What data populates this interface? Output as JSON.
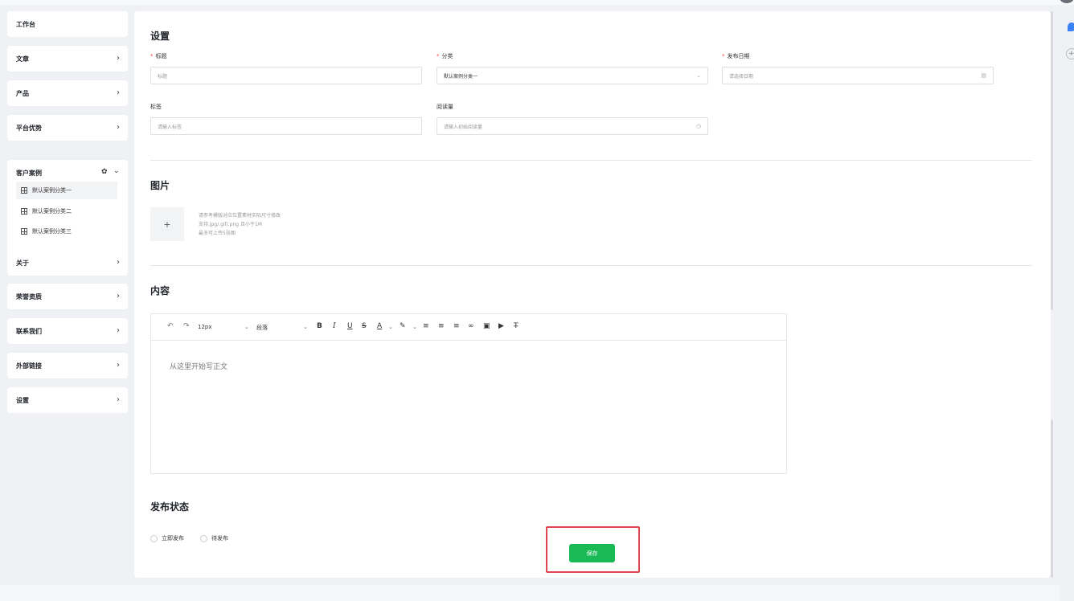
{
  "sidebar": {
    "items": [
      {
        "label": "工作台",
        "chevron": false
      },
      {
        "label": "文章",
        "chevron": true
      },
      {
        "label": "产品",
        "chevron": true
      },
      {
        "label": "平台优势",
        "chevron": true
      },
      {
        "label": "关于",
        "chevron": true
      },
      {
        "label": "荣誉资质",
        "chevron": true
      },
      {
        "label": "联系我们",
        "chevron": true
      },
      {
        "label": "外部链接",
        "chevron": true
      },
      {
        "label": "设置",
        "chevron": true
      }
    ],
    "group": {
      "label": "客户案例",
      "subitems": [
        {
          "label": "默认案例分类一",
          "active": true
        },
        {
          "label": "默认案例分类二",
          "active": false
        },
        {
          "label": "默认案例分类三",
          "active": false
        }
      ]
    },
    "chevron_glyph": "›"
  },
  "settings": {
    "title": "设置",
    "required_mark": "*",
    "fields": {
      "title": {
        "label": "标题",
        "placeholder": "标题"
      },
      "category": {
        "label": "分类",
        "value": "默认案例分类一"
      },
      "publish_date": {
        "label": "发布日期",
        "placeholder": "请选择日期"
      },
      "tags": {
        "label": "标签",
        "placeholder": "请输入标签"
      },
      "reads": {
        "label": "阅读量",
        "placeholder": "请输入初始阅读量"
      }
    }
  },
  "images": {
    "title": "图片",
    "upload_plus": "+",
    "tips": [
      "请参考模版对应位置素材实际尺寸修改",
      "支持.jpg/.gif/.png 且小于1M",
      "最多可上传5张图"
    ]
  },
  "content": {
    "title": "内容",
    "toolbar": {
      "undo": "↶",
      "redo": "↷",
      "font_size": "12px",
      "paragraph": "段落",
      "bold": "B",
      "italic": "I",
      "underline": "U",
      "strike": "S",
      "font_color": "A",
      "highlight": "✎",
      "align_left": "≡",
      "align_center": "≡",
      "align_right": "≡",
      "link": "∞",
      "image": "▣",
      "video": "▶",
      "clear_format": "T̶"
    },
    "placeholder": "从这里开始写正文"
  },
  "publish": {
    "title": "发布状态",
    "options": [
      "立即发布",
      "待发布"
    ]
  },
  "save_label": "保存",
  "colors": {
    "accent": "#19b955",
    "highlight_frame": "#e0464f",
    "required": "#f54a45"
  }
}
